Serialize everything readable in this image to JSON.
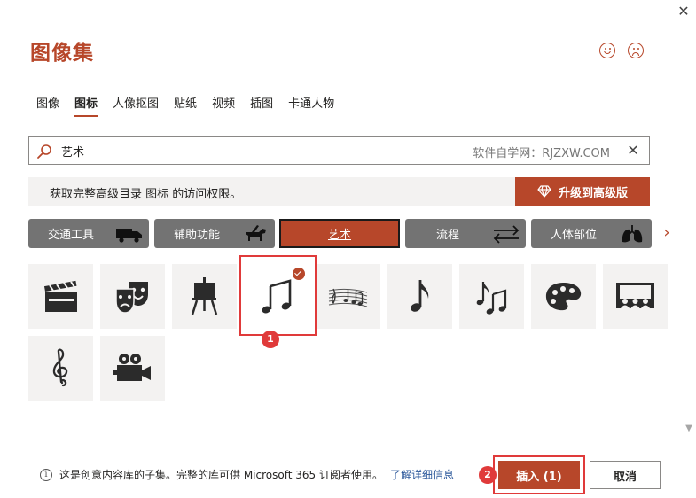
{
  "dialog": {
    "title": "图像集",
    "close_symbol": "✕"
  },
  "feedback": {
    "positive_icon": "smile-icon",
    "negative_icon": "frown-icon"
  },
  "tabs": [
    {
      "label": "图像",
      "active": false
    },
    {
      "label": "图标",
      "active": true
    },
    {
      "label": "人像抠图",
      "active": false
    },
    {
      "label": "贴纸",
      "active": false
    },
    {
      "label": "视频",
      "active": false
    },
    {
      "label": "插图",
      "active": false
    },
    {
      "label": "卡通人物",
      "active": false
    }
  ],
  "search": {
    "value": "艺术",
    "hint": "软件自学网：RJZXW.COM",
    "clear_symbol": "✕"
  },
  "upsell": {
    "text": "获取完整高级目录 图标 的访问权限。",
    "button_label": "升级到高级版"
  },
  "categories": [
    {
      "label": "交通工具",
      "icon": "truck-icon",
      "active": false
    },
    {
      "label": "辅助功能",
      "icon": "guide-dog-icon",
      "active": false
    },
    {
      "label": "艺术",
      "icon": "",
      "active": true
    },
    {
      "label": "流程",
      "icon": "swap-arrows-icon",
      "active": false
    },
    {
      "label": "人体部位",
      "icon": "lungs-icon",
      "active": false
    }
  ],
  "category_next_symbol": "›",
  "icons": [
    {
      "name": "clapperboard-icon",
      "selected": false
    },
    {
      "name": "theater-masks-icon",
      "selected": false
    },
    {
      "name": "easel-icon",
      "selected": false
    },
    {
      "name": "music-notes-icon",
      "selected": true
    },
    {
      "name": "sheet-music-icon",
      "selected": false
    },
    {
      "name": "eighth-note-icon",
      "selected": false
    },
    {
      "name": "eighth-notes-icon",
      "selected": false
    },
    {
      "name": "palette-icon",
      "selected": false
    },
    {
      "name": "cinema-audience-icon",
      "selected": false
    },
    {
      "name": "treble-clef-icon",
      "selected": false
    },
    {
      "name": "video-camera-icon",
      "selected": false
    }
  ],
  "annotations": {
    "badge_1": "1",
    "badge_2": "2",
    "color": "#e03a3a"
  },
  "footer": {
    "info_symbol": "i",
    "info_text": "这是创意内容库的子集。完整的库可供 Microsoft 365 订阅者使用。",
    "learn_more": "了解详细信息",
    "insert_label": "插入 (1)",
    "cancel_label": "取消"
  },
  "colors": {
    "accent": "#b7472a",
    "category_bg": "#737373",
    "tile_bg": "#f3f2f1"
  }
}
